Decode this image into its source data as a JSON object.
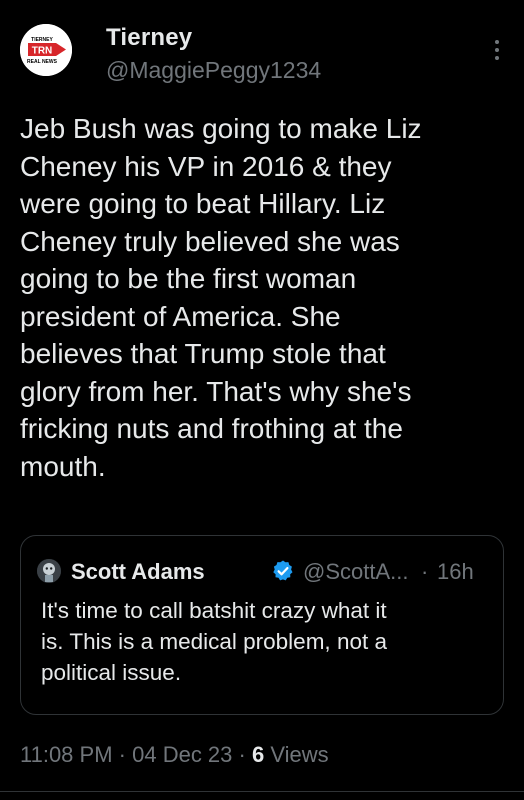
{
  "author": {
    "display_name": "Tierney",
    "handle": "@MaggiePeggy1234",
    "avatar": {
      "icon": "trn-logo-avatar",
      "logo_top": "TIERNEY",
      "logo_main": "TRN",
      "logo_bottom": "REAL NEWS"
    }
  },
  "more_icon": "more-options-icon",
  "tweet": {
    "lines": [
      "Jeb Bush was going to make Liz",
      "Cheney his VP in 2016 & they",
      "were going to beat Hillary. Liz",
      "Cheney truly believed she was",
      "going to be the first woman",
      "president of America. She",
      "believes that Trump stole that",
      "glory from her. That's why she's",
      "fricking nuts and frothing at the",
      "mouth."
    ]
  },
  "quote": {
    "display_name": "Scott Adams",
    "verified_icon": "verified-badge-icon",
    "verified_color": "#1d9bf0",
    "handle": "@ScottA...",
    "separator": "·",
    "time": "16h",
    "lines": [
      "It's time to call batshit crazy what it",
      "is. This is a medical problem, not a",
      "political issue."
    ]
  },
  "meta": {
    "time": "11:08 PM",
    "sep1": " · ",
    "date": "04 Dec 23",
    "sep2": " · ",
    "views_count": "6",
    "views_label": " Views"
  },
  "colors": {
    "background": "#000000",
    "text": "#e7e9ea",
    "secondary": "#71767b",
    "border": "#2f3336",
    "logo_red": "#d7262a"
  }
}
